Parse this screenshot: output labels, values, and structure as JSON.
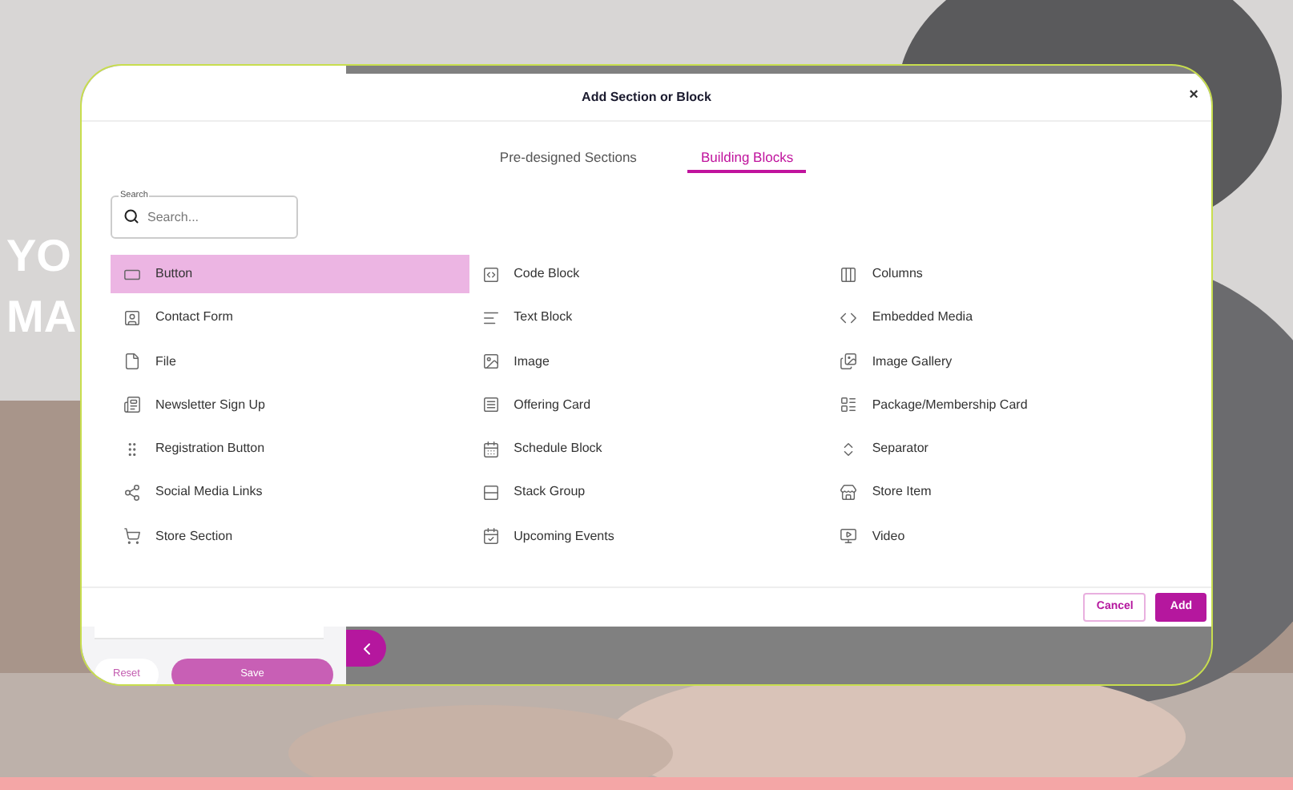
{
  "hero": {
    "heading_lines": [
      "YO",
      "MA"
    ]
  },
  "dialog": {
    "title": "Add Section or Block",
    "close": "×",
    "tabs": [
      {
        "label": "Pre-designed Sections",
        "selected": false
      },
      {
        "label": "Building Blocks",
        "selected": true
      }
    ],
    "search": {
      "label": "Search",
      "placeholder": "Search..."
    },
    "blocks": [
      {
        "label": "Button",
        "selected": true
      },
      {
        "label": "Code Block",
        "selected": false
      },
      {
        "label": "Columns",
        "selected": false
      },
      {
        "label": "Contact Form",
        "selected": false
      },
      {
        "label": "Text Block",
        "selected": false
      },
      {
        "label": "Embedded Media",
        "selected": false
      },
      {
        "label": "File",
        "selected": false
      },
      {
        "label": "Image",
        "selected": false
      },
      {
        "label": "Image Gallery",
        "selected": false
      },
      {
        "label": "Newsletter Sign Up",
        "selected": false
      },
      {
        "label": "Offering Card",
        "selected": false
      },
      {
        "label": "Package/Membership Card",
        "selected": false
      },
      {
        "label": "Registration Button",
        "selected": false
      },
      {
        "label": "Schedule Block",
        "selected": false
      },
      {
        "label": "Separator",
        "selected": false
      },
      {
        "label": "Social Media Links",
        "selected": false
      },
      {
        "label": "Stack Group",
        "selected": false
      },
      {
        "label": "Store Item",
        "selected": false
      },
      {
        "label": "Store Section",
        "selected": false
      },
      {
        "label": "Upcoming Events",
        "selected": false
      },
      {
        "label": "Video",
        "selected": false
      }
    ],
    "buttons": [
      {
        "label": "Cancel",
        "kind": "outline"
      },
      {
        "label": "Add",
        "kind": "primary"
      }
    ]
  },
  "side_panel": {
    "buttons": [
      {
        "label": "Reset",
        "kind": "text"
      },
      {
        "label": "Save",
        "kind": "pill"
      }
    ]
  }
}
